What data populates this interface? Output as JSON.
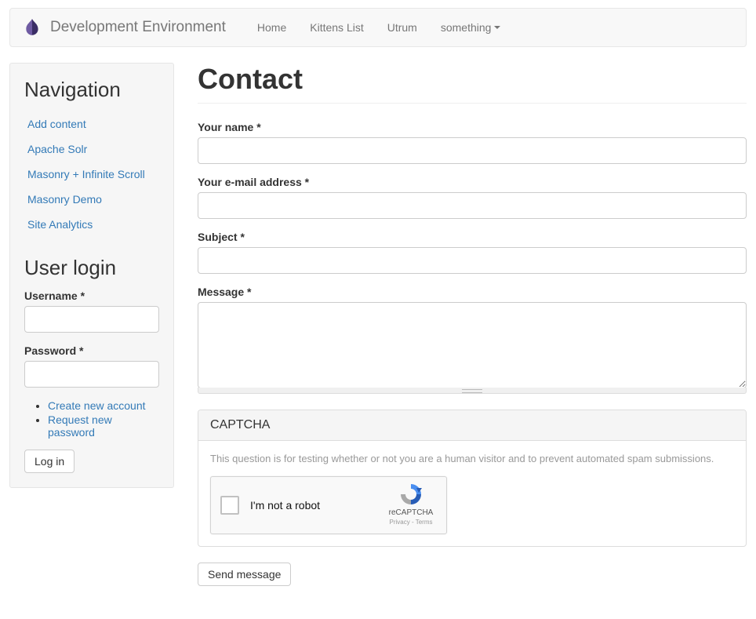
{
  "header": {
    "brand": "Development Environment",
    "nav": [
      "Home",
      "Kittens List",
      "Utrum",
      "something"
    ]
  },
  "sidebar": {
    "nav_title": "Navigation",
    "nav_items": [
      "Add content",
      "Apache Solr",
      "Masonry + Infinite Scroll",
      "Masonry Demo",
      "Site Analytics"
    ],
    "login_title": "User login",
    "username_label": "Username *",
    "password_label": "Password *",
    "login_links": [
      "Create new account",
      "Request new password"
    ],
    "login_button": "Log in"
  },
  "main": {
    "title": "Contact",
    "name_label": "Your name *",
    "email_label": "Your e-mail address *",
    "subject_label": "Subject *",
    "message_label": "Message *",
    "captcha_title": "CAPTCHA",
    "captcha_desc": "This question is for testing whether or not you are a human visitor and to prevent automated spam submissions.",
    "recaptcha_label": "I'm not a robot",
    "recaptcha_brand": "reCAPTCHA",
    "recaptcha_legal": "Privacy - Terms",
    "submit_label": "Send message"
  }
}
